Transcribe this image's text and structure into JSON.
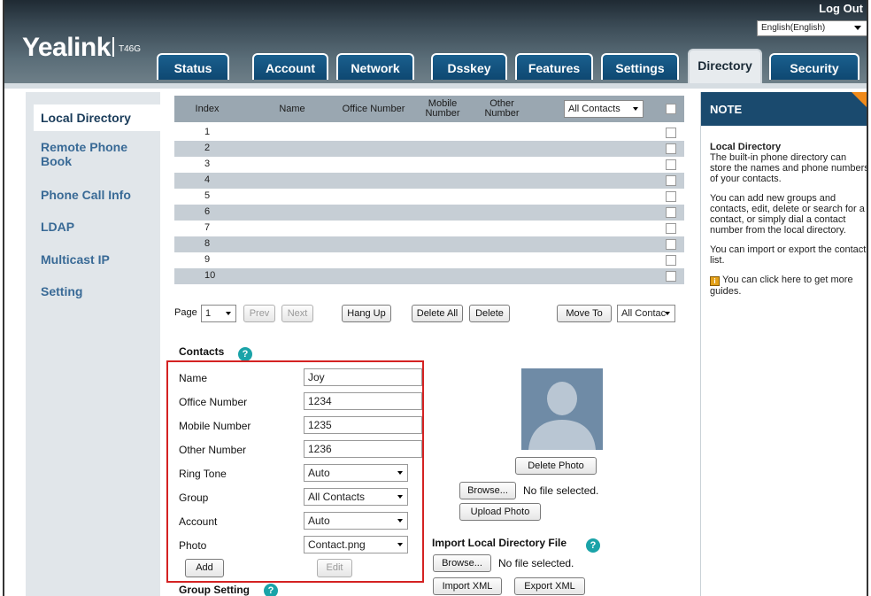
{
  "header": {
    "logo": "Yealink",
    "model": "T46G",
    "logout": "Log Out",
    "language": "English(English)",
    "tabs": [
      "Status",
      "Account",
      "Network",
      "Dsskey",
      "Features",
      "Settings",
      "Directory",
      "Security"
    ],
    "active_tab": "Directory"
  },
  "sidebar": {
    "items": [
      {
        "label": "Local Directory",
        "active": true
      },
      {
        "label": "Remote Phone Book"
      },
      {
        "label": "Phone Call Info"
      },
      {
        "label": "LDAP"
      },
      {
        "label": "Multicast IP"
      },
      {
        "label": "Setting"
      }
    ]
  },
  "table": {
    "headers": {
      "index": "Index",
      "name": "Name",
      "office": "Office Number",
      "mobile": "Mobile Number",
      "other": "Other Number"
    },
    "group_filter": "All Contacts",
    "rows": [
      "1",
      "2",
      "3",
      "4",
      "5",
      "6",
      "7",
      "8",
      "9",
      "10"
    ],
    "pager": {
      "page_label": "Page",
      "page_value": "1",
      "prev": "Prev",
      "next": "Next",
      "hang_up": "Hang Up",
      "delete_all": "Delete All",
      "delete": "Delete",
      "move_to": "Move To",
      "move_target": "All Contac"
    }
  },
  "contacts": {
    "title": "Contacts",
    "fields": {
      "name": {
        "label": "Name",
        "value": "Joy"
      },
      "office": {
        "label": "Office Number",
        "value": "1234"
      },
      "mobile": {
        "label": "Mobile Number",
        "value": "1235"
      },
      "other": {
        "label": "Other Number",
        "value": "1236"
      },
      "ring_tone": {
        "label": "Ring Tone",
        "value": "Auto"
      },
      "group": {
        "label": "Group",
        "value": "All Contacts"
      },
      "account": {
        "label": "Account",
        "value": "Auto"
      },
      "photo": {
        "label": "Photo",
        "value": "Contact.png"
      }
    },
    "add": "Add",
    "edit": "Edit",
    "delete_photo": "Delete Photo",
    "browse": "Browse...",
    "no_file": "No file selected.",
    "upload_photo": "Upload Photo"
  },
  "import": {
    "title": "Import Local Directory File",
    "browse": "Browse...",
    "no_file": "No file selected.",
    "import_xml": "Import XML",
    "export_xml": "Export XML"
  },
  "group_setting": {
    "title": "Group Setting"
  },
  "note": {
    "title": "NOTE",
    "heading": "Local Directory",
    "p1": "The built-in phone directory can store the names and phone numbers of your contacts.",
    "p2": "You can add new groups and contacts, edit, delete or search for a contact, or simply dial a contact number from the local directory.",
    "p3": "You can import or export the contact list.",
    "p4": "You can click here to get more guides."
  },
  "colors": {
    "tab_blue": "#0e4872",
    "nav_link": "#396a96",
    "note_header": "#1a4a6e",
    "note_corner": "#f08a1a",
    "highlight_box": "#d42222",
    "help_icon": "#1aa3a8"
  }
}
